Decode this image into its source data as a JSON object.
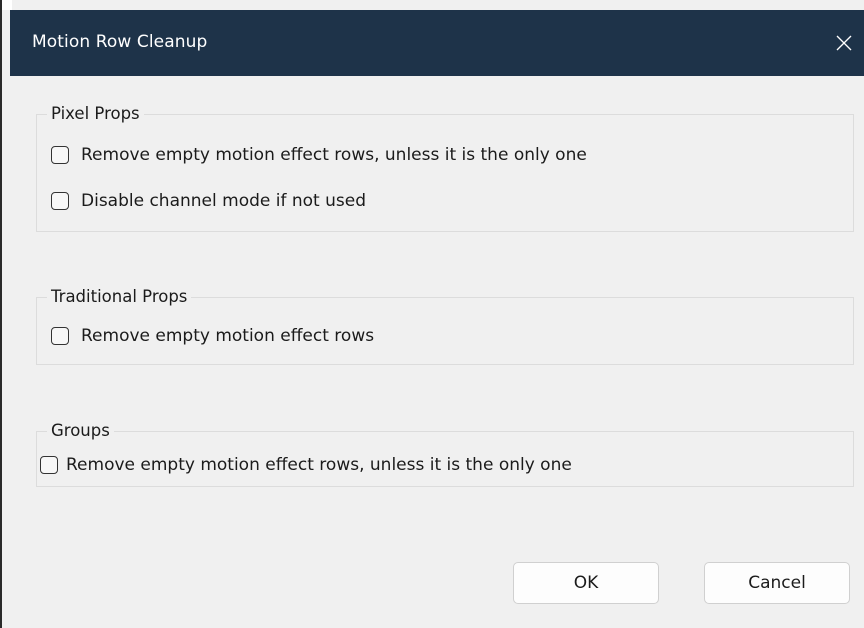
{
  "window": {
    "title": "Motion Row Cleanup",
    "close_icon": "close-icon"
  },
  "groups": {
    "pixel_props": {
      "legend": "Pixel Props",
      "options": [
        {
          "label": "Remove empty motion effect rows, unless it is the only one",
          "checked": false
        },
        {
          "label": "Disable channel mode if not used",
          "checked": false
        }
      ]
    },
    "traditional_props": {
      "legend": "Traditional Props",
      "options": [
        {
          "label": "Remove empty motion effect rows",
          "checked": false
        }
      ]
    },
    "groups": {
      "legend": "Groups",
      "options": [
        {
          "label": "Remove empty motion effect rows, unless it is the only one",
          "checked": false
        }
      ]
    }
  },
  "buttons": {
    "ok_label": "OK",
    "cancel_label": "Cancel"
  },
  "colors": {
    "titlebar": "#1e3349",
    "dialog_background": "#f0f0f0",
    "group_border": "#dcdcdc"
  }
}
